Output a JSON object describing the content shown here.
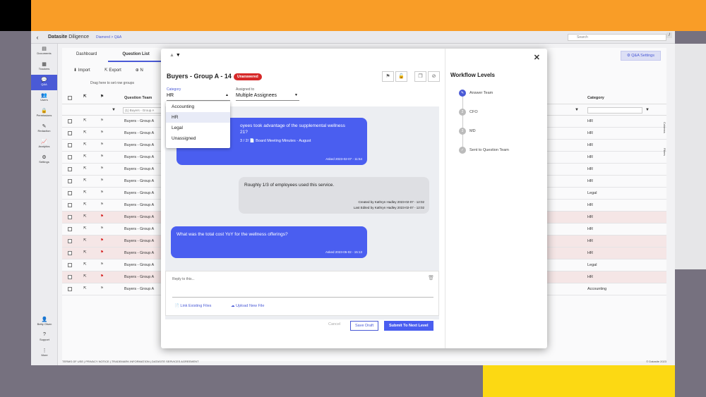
{
  "app": {
    "brand": "Datasite",
    "brand_suffix": "Diligence",
    "breadcrumb": "Diamond > Q&A",
    "search_placeholder": "Search",
    "search_shortcut": "/"
  },
  "rail": {
    "items": [
      {
        "label": "Documents",
        "icon": "document-icon"
      },
      {
        "label": "Trackers",
        "icon": "tracker-icon"
      },
      {
        "label": "Q&A",
        "icon": "chat-icon",
        "active": true
      },
      {
        "label": "Users",
        "icon": "users-icon"
      },
      {
        "label": "Permissions",
        "icon": "lock-icon"
      },
      {
        "label": "Redaction",
        "icon": "redaction-icon"
      },
      {
        "label": "Analytics",
        "icon": "analytics-icon"
      },
      {
        "label": "Settings",
        "icon": "gear-icon"
      }
    ],
    "bottom": [
      {
        "label": "Betty Olsen",
        "icon": "avatar-icon"
      },
      {
        "label": "Support",
        "icon": "help-icon"
      },
      {
        "label": "More",
        "icon": "more-icon"
      }
    ]
  },
  "main": {
    "tabs": [
      "Dashboard",
      "Question List"
    ],
    "qa_settings": "Q&A Settings",
    "toolbar": [
      "Import",
      "Export",
      "N"
    ],
    "group_hint": "Drag here to set row groups",
    "col_team": "Question Team",
    "col_category": "Category",
    "filter_team": "(1) Buyers - Group A",
    "right_labels": [
      "Columns",
      "Filters"
    ],
    "rows": [
      {
        "team": "Buyers - Group A",
        "cat": "HR",
        "flag": false
      },
      {
        "team": "Buyers - Group A",
        "cat": "HR",
        "flag": false
      },
      {
        "team": "Buyers - Group A",
        "cat": "HR",
        "flag": false
      },
      {
        "team": "Buyers - Group A",
        "cat": "HR",
        "flag": false
      },
      {
        "team": "Buyers - Group A",
        "cat": "HR",
        "flag": false
      },
      {
        "team": "Buyers - Group A",
        "cat": "HR",
        "flag": false
      },
      {
        "team": "Buyers - Group A",
        "cat": "Legal",
        "flag": false
      },
      {
        "team": "Buyers - Group A",
        "cat": "HR",
        "flag": false
      },
      {
        "team": "Buyers - Group A",
        "cat": "HR",
        "flag": true
      },
      {
        "team": "Buyers - Group A",
        "cat": "HR",
        "flag": false
      },
      {
        "team": "Buyers - Group A",
        "cat": "HR",
        "flag": true
      },
      {
        "team": "Buyers - Group A",
        "cat": "HR",
        "flag": true
      },
      {
        "team": "Buyers - Group A",
        "cat": "Legal",
        "flag": false
      },
      {
        "team": "Buyers - Group A",
        "cat": "HR",
        "flag": true
      },
      {
        "team": "Buyers - Group A",
        "cat": "Accounting",
        "flag": false
      }
    ],
    "footer_left": "TERMS OF USE | PRIVACY NOTICE | TRADEMARK INFORMATION | DATASITE SERVICES AGREEMENT",
    "footer_right": "© Datasite 2023"
  },
  "modal": {
    "title": "Buyers - Group A - 14",
    "status": "Unanswered",
    "category_label": "Category",
    "category_value": "HR",
    "assigned_label": "Assigned to",
    "assigned_value": "Multiple Assignees",
    "category_options": [
      "Accounting",
      "HR",
      "Legal",
      "Unassigned"
    ],
    "messages": [
      {
        "kind": "blue",
        "line1": "oyees took advantage of the supplemental wellness",
        "line2": "21?",
        "attach": "3 / 2/ 📄 Board Meeting Minutes - August",
        "meta": "Asked 2023-02-07 - 11:54"
      },
      {
        "kind": "grey",
        "text": "Roughly 1/3 of employees used this service.",
        "meta1": "Created by Kathryn Hadley 2023-02-07 - 12:02",
        "meta2": "Last Edited by Kathryn Hadley 2023-02-07 - 12:02"
      },
      {
        "kind": "blue",
        "text": "What was the total cost YoY for the wellness offerings?",
        "meta": "Asked 2023-05-02 - 15:13"
      }
    ],
    "reply_placeholder": "Reply to this...",
    "link_files": "Link Existing Files",
    "upload_file": "Upload New File",
    "cancel": "Cancel",
    "save_draft": "Save Draft",
    "submit": "Submit To Next Level",
    "workflow_title": "Workflow Levels",
    "workflow": [
      {
        "num": "✎",
        "label": "Answer Team",
        "active": true
      },
      {
        "num": "2",
        "label": "CFO",
        "active": false
      },
      {
        "num": "3",
        "label": "MD",
        "active": false
      },
      {
        "num": "✓",
        "label": "Sent to Question Team",
        "active": false
      }
    ]
  },
  "colors": {
    "accent": "#4a5ef0",
    "orange": "#f99d27",
    "yellow": "#fcd913",
    "badge": "#d62828"
  }
}
